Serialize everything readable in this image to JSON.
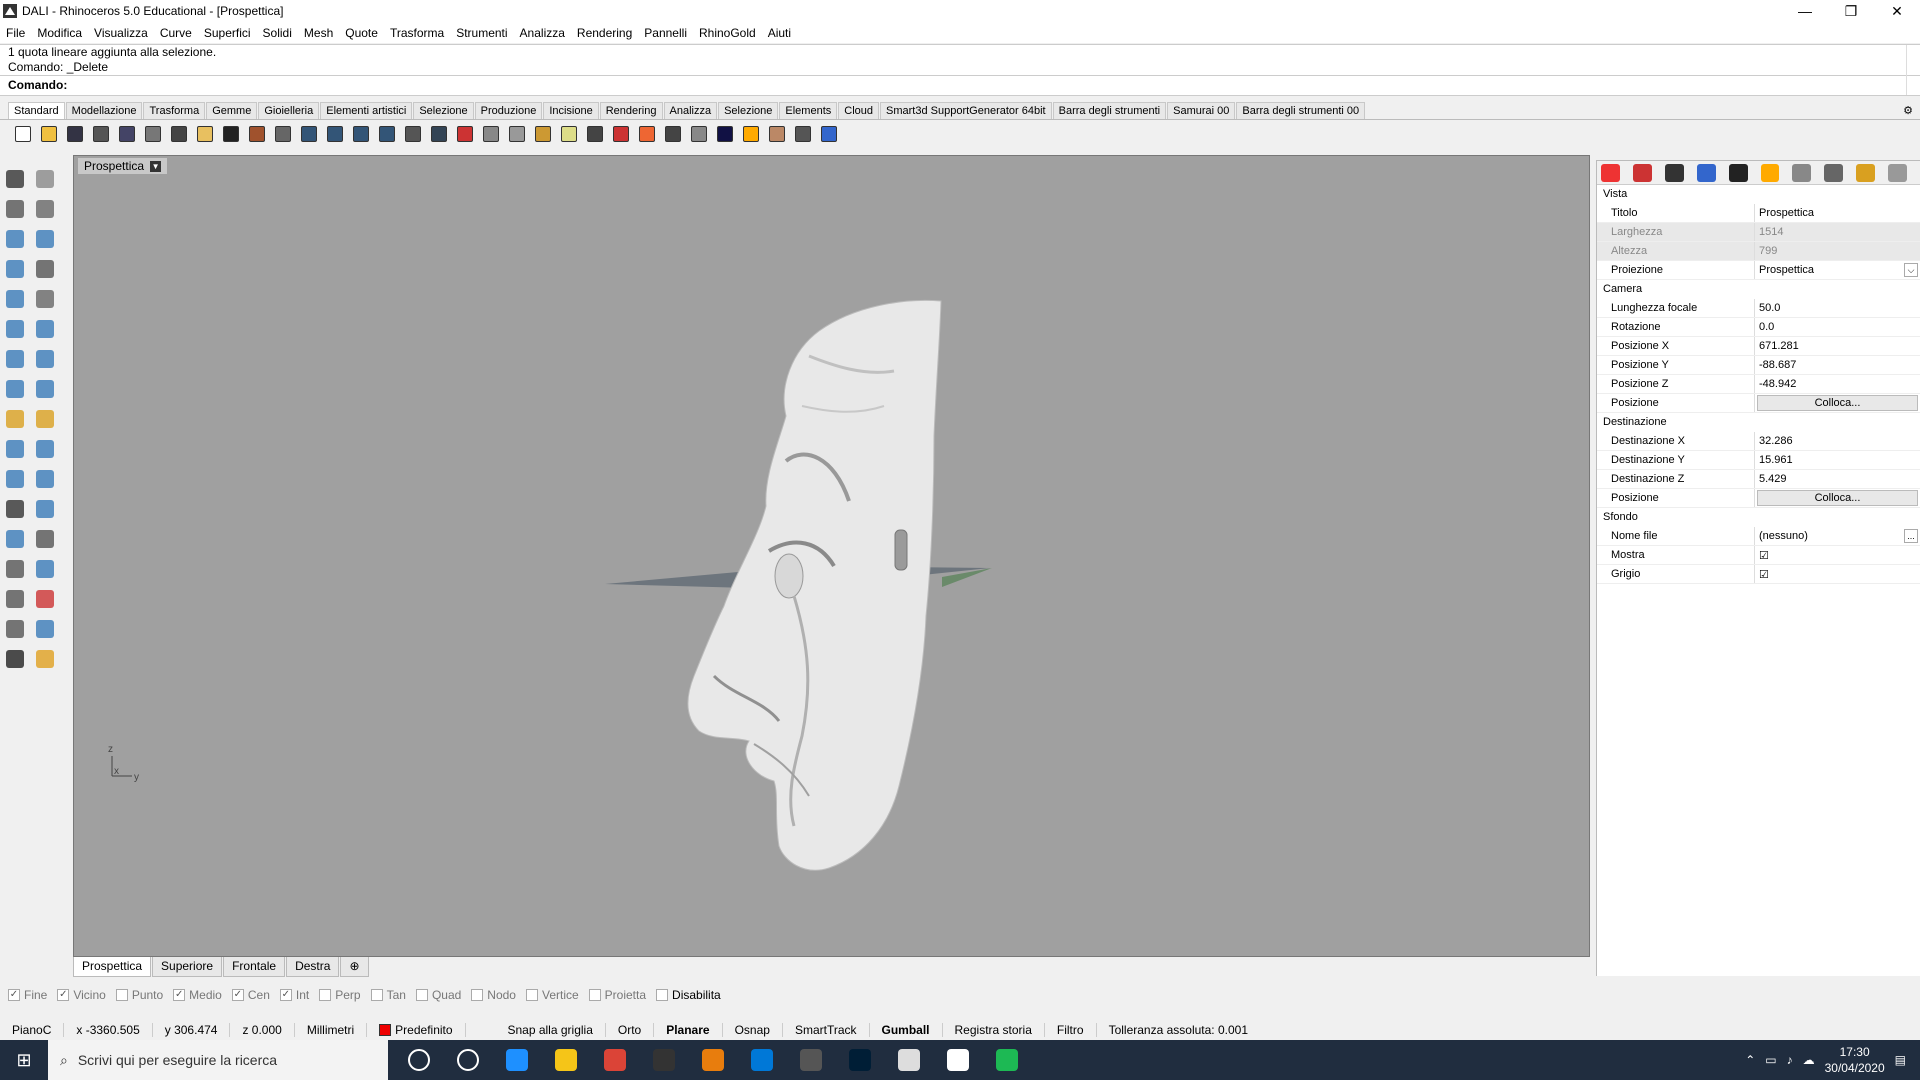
{
  "window": {
    "title": "DALI - Rhinoceros 5.0 Educational - [Prospettica]",
    "minimize": "—",
    "restore": "❐",
    "close": "✕"
  },
  "menu": [
    "File",
    "Modifica",
    "Visualizza",
    "Curve",
    "Superfici",
    "Solidi",
    "Mesh",
    "Quote",
    "Trasforma",
    "Strumenti",
    "Analizza",
    "Rendering",
    "Pannelli",
    "RhinoGold",
    "Aiuti"
  ],
  "command": {
    "history1": "1 quota lineare aggiunta alla selezione.",
    "history2": "Comando: _Delete",
    "prompt": "Comando:"
  },
  "toolbar_tabs": [
    "Standard",
    "Modellazione",
    "Trasforma",
    "Gemme",
    "Gioielleria",
    "Elementi artistici",
    "Selezione",
    "Produzione",
    "Incisione",
    "Rendering",
    "Analizza",
    "Selezione",
    "Elements",
    "Cloud",
    "Smart3d SupportGenerator 64bit",
    "Barra degli strumenti",
    "Samurai 00",
    "Barra degli strumenti 00"
  ],
  "active_tab": "Standard",
  "viewport": {
    "title": "Prospettica",
    "axis_z": "z",
    "axis_x": "x",
    "axis_y": "y"
  },
  "view_tabs": [
    "Prospettica",
    "Superiore",
    "Frontale",
    "Destra"
  ],
  "view_add": "⊕",
  "osnap": [
    {
      "label": "Fine",
      "checked": true
    },
    {
      "label": "Vicino",
      "checked": true
    },
    {
      "label": "Punto",
      "checked": false
    },
    {
      "label": "Medio",
      "checked": true
    },
    {
      "label": "Cen",
      "checked": true
    },
    {
      "label": "Int",
      "checked": true
    },
    {
      "label": "Perp",
      "checked": false
    },
    {
      "label": "Tan",
      "checked": false
    },
    {
      "label": "Quad",
      "checked": false
    },
    {
      "label": "Nodo",
      "checked": false
    },
    {
      "label": "Vertice",
      "checked": false
    },
    {
      "label": "Proietta",
      "checked": false
    },
    {
      "label": "Disabilita",
      "checked": false
    }
  ],
  "status": {
    "cplane": "PianoC",
    "x": "x -3360.505",
    "y": "y 306.474",
    "z": "z 0.000",
    "units": "Millimetri",
    "layer": "Predefinito",
    "snap": "Snap alla griglia",
    "ortho": "Orto",
    "planar": "Planare",
    "osnap": "Osnap",
    "smarttrack": "SmartTrack",
    "gumball": "Gumball",
    "history": "Registra storia",
    "filter": "Filtro",
    "tolerance": "Tolleranza assoluta: 0.001"
  },
  "properties": {
    "sec_vista": "Vista",
    "titolo": {
      "label": "Titolo",
      "value": "Prospettica"
    },
    "larghezza": {
      "label": "Larghezza",
      "value": "1514"
    },
    "altezza": {
      "label": "Altezza",
      "value": "799"
    },
    "proiezione": {
      "label": "Proiezione",
      "value": "Prospettica"
    },
    "sec_camera": "Camera",
    "lunghezza": {
      "label": "Lunghezza focale",
      "value": "50.0"
    },
    "rotazione": {
      "label": "Rotazione",
      "value": "0.0"
    },
    "posx": {
      "label": "Posizione X",
      "value": "671.281"
    },
    "posy": {
      "label": "Posizione Y",
      "value": "-88.687"
    },
    "posz": {
      "label": "Posizione Z",
      "value": "-48.942"
    },
    "pos1": {
      "label": "Posizione",
      "value": "Colloca..."
    },
    "sec_dest": "Destinazione",
    "destx": {
      "label": "Destinazione X",
      "value": "32.286"
    },
    "desty": {
      "label": "Destinazione Y",
      "value": "15.961"
    },
    "destz": {
      "label": "Destinazione Z",
      "value": "5.429"
    },
    "pos2": {
      "label": "Posizione",
      "value": "Colloca..."
    },
    "sec_sfondo": "Sfondo",
    "nomefile": {
      "label": "Nome file",
      "value": "(nessuno)",
      "button": "..."
    },
    "mostra": {
      "label": "Mostra",
      "value": "☑"
    },
    "grigio": {
      "label": "Grigio",
      "value": "☑"
    }
  },
  "taskbar": {
    "search": "Scrivi qui per eseguire la ricerca",
    "time": "17:30",
    "date": "30/04/2020"
  }
}
